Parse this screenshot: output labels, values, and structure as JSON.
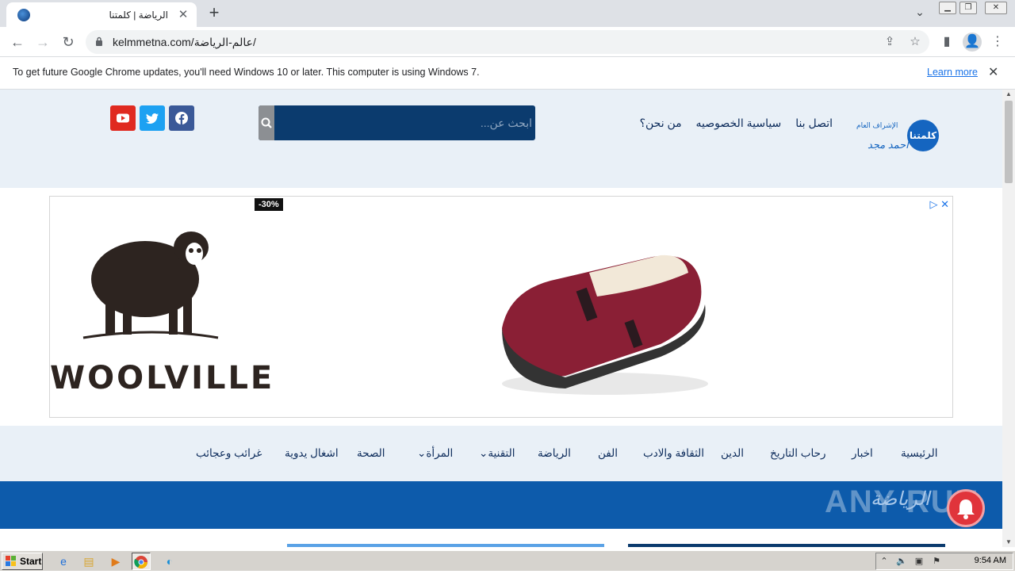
{
  "browser": {
    "tab_title": "الرياضة | كلمتنا",
    "new_tab_symbol": "+",
    "url": "kelmmetna.com/عالم-الرياضة/",
    "infobar_text": "To get future Google Chrome updates, you'll need Windows 10 or later. This computer is using Windows 7.",
    "infobar_link": "Learn more"
  },
  "site": {
    "logo_text": "كلمتنا",
    "logo_sub": "الإشراف العام",
    "logo_name": "أحمد مجد",
    "top_links": [
      "اتصل بنا",
      "سياسية الخصوصيه",
      "من نحن؟"
    ],
    "search_placeholder": "ابحث عن...",
    "social": [
      "youtube-icon",
      "twitter-icon",
      "facebook-icon"
    ],
    "colors": {
      "header_bg": "#e9f0f7",
      "search_bg": "#0b3b6e",
      "banner_bg": "#0d5bab",
      "youtube": "#e02a20",
      "twitter": "#1da1f2",
      "facebook": "#3b5998"
    }
  },
  "ad": {
    "brand": "WOOLVILLE",
    "discount": "-30%"
  },
  "nav": {
    "items": [
      "الرئيسية",
      "اخبار",
      "رحاب التاريخ",
      "الدين",
      "الثقافة والادب",
      "الفن",
      "الرياضة",
      "التقنية",
      "المرأة",
      "الصحة",
      "اشغال يدوية",
      "غرائب وعجائب"
    ]
  },
  "category": {
    "title": "الرياضة",
    "watermark": "ANY RUN"
  },
  "taskbar": {
    "start_label": "Start",
    "clock": "9:54 AM"
  }
}
